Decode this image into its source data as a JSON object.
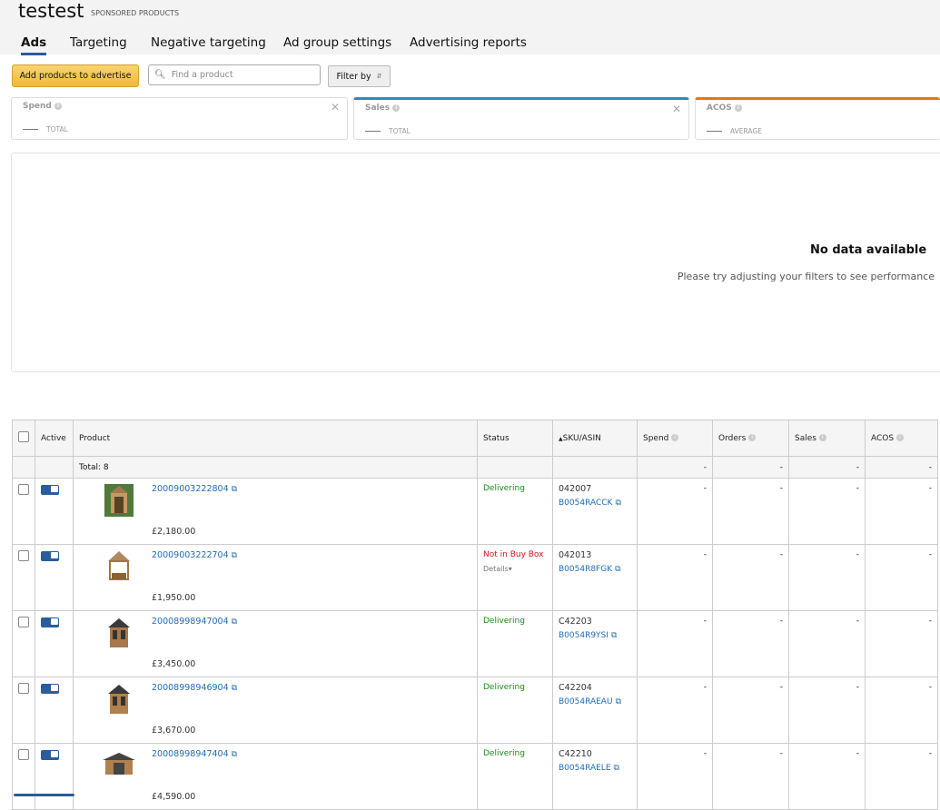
{
  "header": {
    "title": "testest",
    "subtitle": "SPONSORED PRODUCTS"
  },
  "tabs": [
    {
      "label": "Ads",
      "active": true
    },
    {
      "label": "Targeting"
    },
    {
      "label": "Negative targeting"
    },
    {
      "label": "Ad group settings"
    },
    {
      "label": "Advertising reports"
    }
  ],
  "toolbar": {
    "add_label": "Add products to advertise",
    "search_placeholder": "Find a product",
    "search_value": "",
    "filter_label": "Filter by"
  },
  "metric_cards": [
    {
      "label": "Spend",
      "agg": "TOTAL",
      "color": "#dddddd"
    },
    {
      "label": "Sales",
      "agg": "TOTAL",
      "color": "#2e8bc0"
    },
    {
      "label": "ACOS",
      "agg": "AVERAGE",
      "color": "#e07b00"
    }
  ],
  "chart": {
    "no_data_title": "No data available",
    "no_data_message": "Please try adjusting your filters to see performance"
  },
  "table": {
    "columns": {
      "active": "Active",
      "product": "Product",
      "status": "Status",
      "sku": "SKU/ASIN",
      "spend": "Spend",
      "orders": "Orders",
      "sales": "Sales",
      "acos": "ACOS"
    },
    "total_label": "Total: 8",
    "total_values": {
      "spend": "-",
      "orders": "-",
      "sales": "-",
      "acos": "-"
    },
    "rows": [
      {
        "product_id": "20009003222804",
        "price": "£2,180.00",
        "status": "Delivering",
        "status_type": "ok",
        "sku": "042007",
        "asin": "B0054RACCK",
        "spend": "-",
        "orders": "-",
        "sales": "-",
        "acos": "-"
      },
      {
        "product_id": "20009003222704",
        "price": "£1,950.00",
        "status": "Not in Buy Box",
        "status_type": "error",
        "details": "Details",
        "sku": "042013",
        "asin": "B0054R8FGK",
        "spend": "-",
        "orders": "-",
        "sales": "-",
        "acos": "-"
      },
      {
        "product_id": "20008998947004",
        "price": "£3,450.00",
        "status": "Delivering",
        "status_type": "ok",
        "sku": "C42203",
        "asin": "B0054R9YSI",
        "spend": "-",
        "orders": "-",
        "sales": "-",
        "acos": "-"
      },
      {
        "product_id": "20008998946904",
        "price": "£3,670.00",
        "status": "Delivering",
        "status_type": "ok",
        "sku": "C42204",
        "asin": "B0054RAEAU",
        "spend": "-",
        "orders": "-",
        "sales": "-",
        "acos": "-"
      },
      {
        "product_id": "20008998947404",
        "price": "£4,590.00",
        "status": "Delivering",
        "status_type": "ok",
        "sku": "C42210",
        "asin": "B0054RAELE",
        "spend": "-",
        "orders": "-",
        "sales": "-",
        "acos": "-"
      }
    ]
  }
}
